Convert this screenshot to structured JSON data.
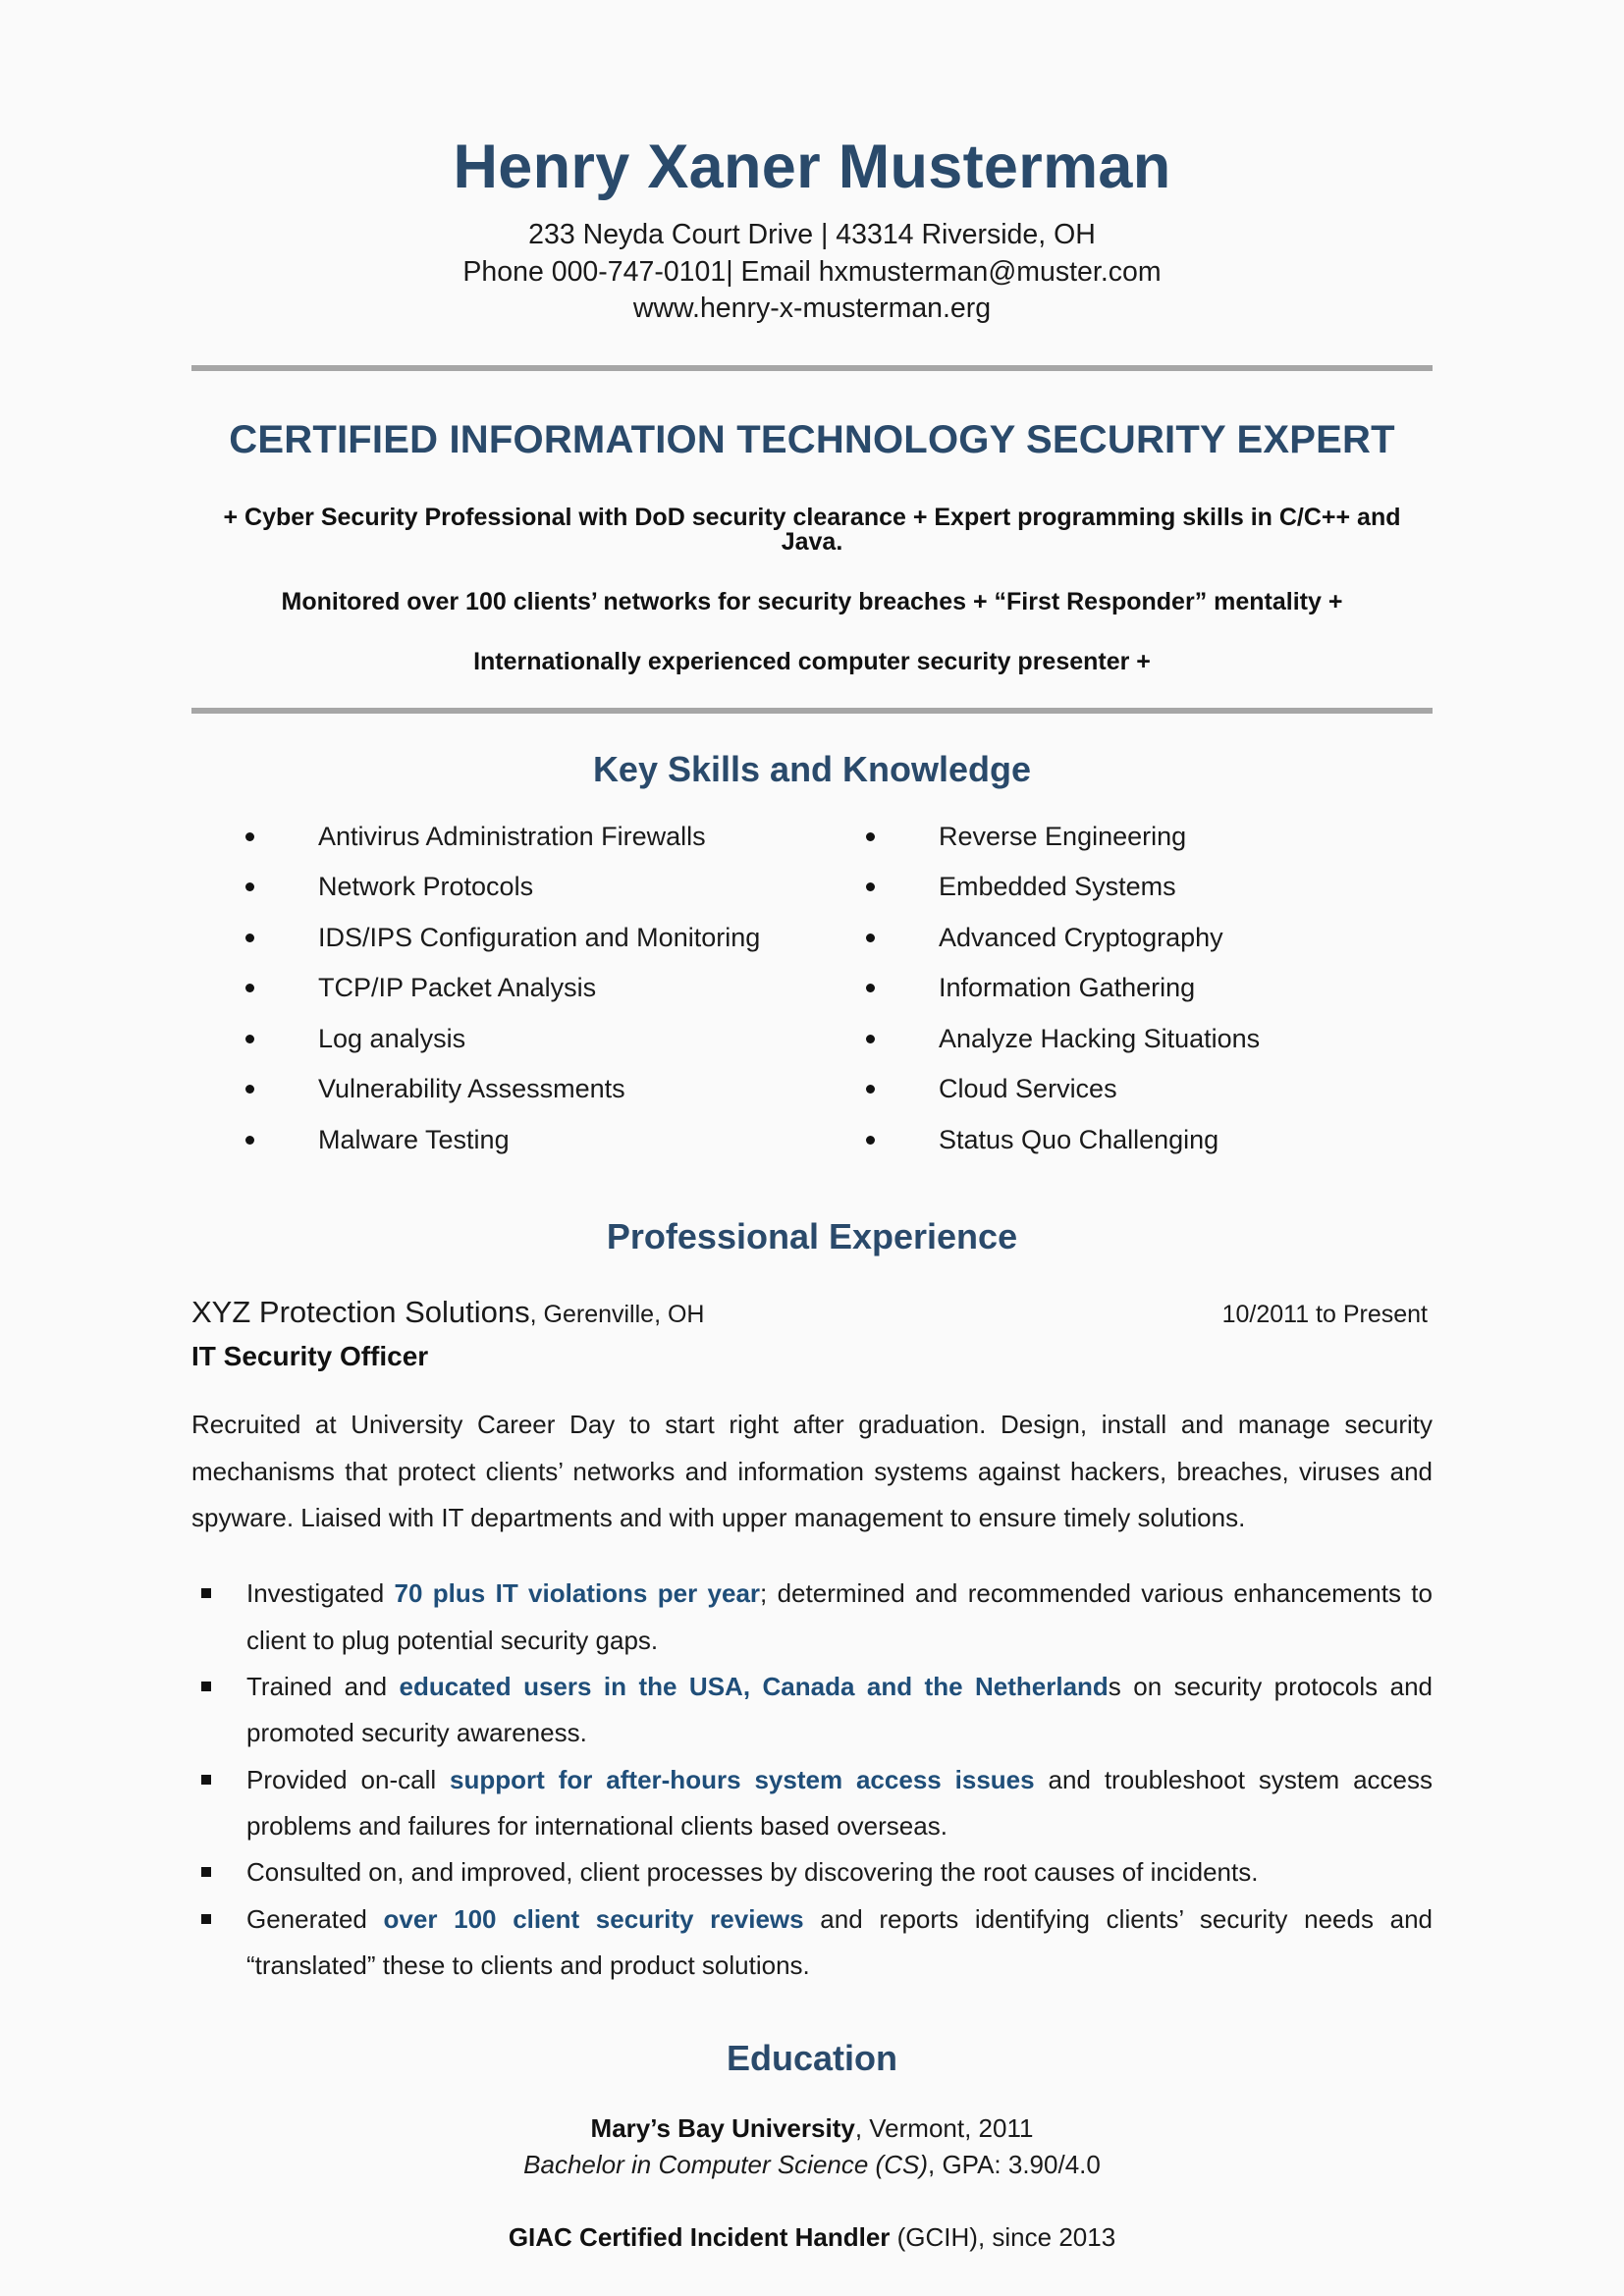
{
  "document": {
    "type": "resume",
    "background_color": "#fafafa",
    "accent_color": "#2a4a6b",
    "highlight_color": "#1f4e79",
    "rule_color": "#a6a6a6"
  },
  "header": {
    "name": "Henry Xaner Musterman",
    "address_line": "233 Neyda Court Drive | 43314 Riverside, OH",
    "phone_email_line": "Phone 000-747-0101| Email hxmusterman@muster.com",
    "website_line": "www.henry-x-musterman.erg"
  },
  "headline": "CERTIFIED INFORMATION TECHNOLOGY SECURITY EXPERT",
  "summary": {
    "lines": [
      "+ Cyber Security Professional with DoD security clearance + Expert programming skills in C/C++ and Java.",
      "Monitored over 100 clients’ networks for security breaches + “First Responder” mentality +",
      "Internationally experienced computer security presenter +"
    ]
  },
  "skills": {
    "heading": "Key Skills and Knowledge",
    "left_column": [
      "Antivirus Administration Firewalls",
      "Network Protocols",
      "IDS/IPS Configuration and Monitoring",
      "TCP/IP Packet Analysis",
      "Log analysis",
      "Vulnerability Assessments",
      "Malware Testing"
    ],
    "right_column": [
      "Reverse Engineering",
      "Embedded Systems",
      "Advanced Cryptography",
      "Information Gathering",
      "Analyze Hacking Situations",
      "Cloud Services",
      "Status Quo Challenging"
    ]
  },
  "experience": {
    "heading": "Professional Experience",
    "job": {
      "company": "XYZ Protection Solutions",
      "location": ", Gerenville, OH",
      "dates": "10/2011 to Present",
      "title": "IT Security Officer",
      "description": "Recruited at University Career Day to start right after graduation. Design, install and manage security mechanisms that protect clients’ networks and information systems against hackers, breaches, viruses and spyware. Liaised with IT departments and with upper management to ensure timely solutions.",
      "bullets": [
        {
          "pre": "Investigated ",
          "highlight": "70 plus IT violations per year",
          "post": "; determined and recommended various enhancements to client to plug potential security gaps."
        },
        {
          "pre": "Trained and ",
          "highlight": "educated users in the USA, Canada and the Netherland",
          "post": "s on security protocols and promoted security awareness."
        },
        {
          "pre": "Provided on-call ",
          "highlight": "support for after-hours system access issues",
          "post": " and troubleshoot system access problems and failures for international clients based overseas."
        },
        {
          "pre": "Consulted on, and improved, client processes by discovering the root causes of incidents.",
          "highlight": "",
          "post": ""
        },
        {
          "pre": "Generated ",
          "highlight": "over 100 client security reviews",
          "post": " and reports identifying clients’ security needs and “translated” these to clients and product solutions."
        }
      ]
    }
  },
  "education": {
    "heading": "Education",
    "school_name": "Mary’s Bay University",
    "school_rest": ", Vermont, 2011",
    "degree": "Bachelor in Computer Science (CS)",
    "degree_rest": ", GPA: 3.90/4.0",
    "certification_name": "GIAC Certified Incident Handler",
    "certification_rest": " (GCIH), since 2013"
  }
}
